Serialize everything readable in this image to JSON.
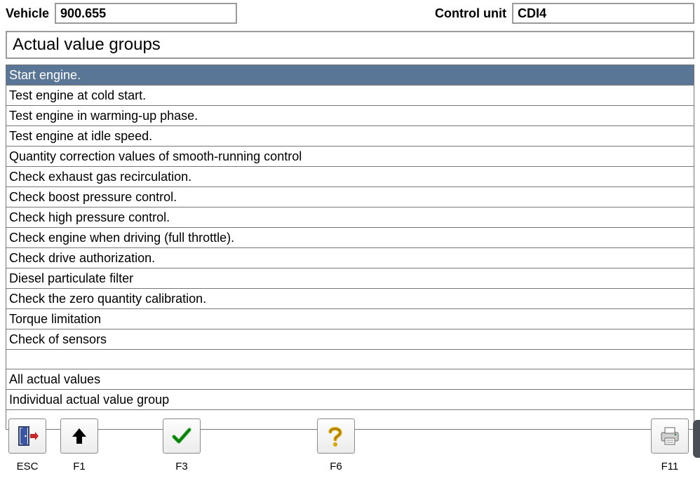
{
  "header": {
    "vehicle_label": "Vehicle",
    "vehicle_value": "900.655",
    "cu_label": "Control unit",
    "cu_value": "CDI4",
    "title": "Actual value groups"
  },
  "list": {
    "items": [
      "Start engine.",
      "Test engine at cold start.",
      "Test engine in warming-up phase.",
      "Test engine at idle speed.",
      "Quantity correction values of smooth-running control",
      "Check exhaust gas recirculation.",
      "Check boost pressure control.",
      "Check high pressure control.",
      "Check engine when driving (full throttle).",
      "Check drive authorization.",
      "Diesel particulate filter",
      "Check the zero quantity calibration.",
      "Torque limitation",
      "Check of sensors",
      "",
      "All actual values",
      "Individual actual value group",
      ""
    ],
    "selected_index": 0
  },
  "footer": {
    "keys": {
      "esc": "ESC",
      "f1": "F1",
      "f3": "F3",
      "f6": "F6",
      "f11": "F11"
    }
  }
}
